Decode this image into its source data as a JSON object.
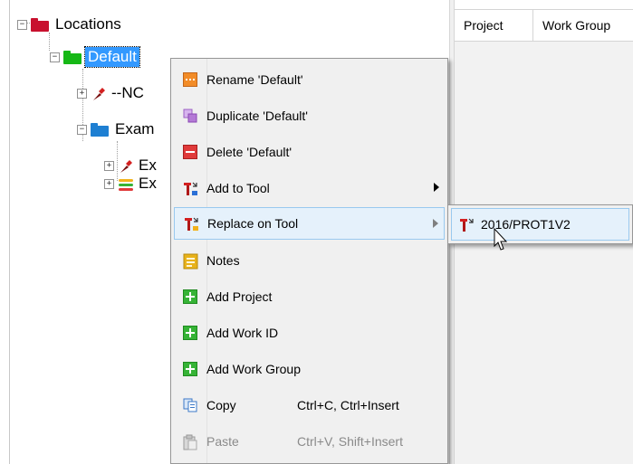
{
  "tree": {
    "root": {
      "label": "Locations",
      "expander": "−",
      "folder_color": "#c8102e"
    },
    "default": {
      "label": "Default",
      "expander": "−",
      "folder_color": "#16b816"
    },
    "child1": {
      "label": "--NC",
      "expander": "+",
      "icon": "tool-icon"
    },
    "child2": {
      "label": "Exam",
      "expander": "−",
      "folder_color": "#1e7fd2"
    },
    "child3": {
      "label": "Ex",
      "expander": "+",
      "icon": "tool-icon"
    },
    "child4": {
      "label": "Ex",
      "expander": "+",
      "icon": "layers-icon"
    }
  },
  "grid": {
    "columns": [
      "Project",
      "Work Group"
    ]
  },
  "context_menu": {
    "items": [
      {
        "label": "Rename 'Default'",
        "icon": "rename-icon"
      },
      {
        "label": "Duplicate 'Default'",
        "icon": "duplicate-icon"
      },
      {
        "label": "Delete 'Default'",
        "icon": "delete-icon"
      },
      {
        "label": "Add to Tool",
        "icon": "add-tool-icon",
        "submenu": true
      },
      {
        "label": "Replace on Tool",
        "icon": "replace-tool-icon",
        "submenu": true,
        "highlighted": true
      },
      {
        "label": "Notes",
        "icon": "notes-icon"
      },
      {
        "label": "Add Project",
        "icon": "plus-icon"
      },
      {
        "label": "Add Work ID",
        "icon": "plus-icon"
      },
      {
        "label": "Add Work Group",
        "icon": "plus-icon"
      },
      {
        "label": "Copy",
        "shortcut": "Ctrl+C, Ctrl+Insert",
        "icon": "copy-icon"
      },
      {
        "label": "Paste",
        "shortcut": "Ctrl+V, Shift+Insert",
        "icon": "paste-icon",
        "disabled": true
      }
    ]
  },
  "submenu": {
    "items": [
      {
        "label": "2016/PROT1V2",
        "icon": "tool-icon"
      }
    ]
  },
  "colors": {
    "selection": "#3399ff",
    "menu_bg": "#f0f0f0",
    "menu_hover": "#e5f1fb",
    "menu_hover_border": "#99c9ef",
    "plus_green": "#36b336",
    "delete_red": "#e03a3a",
    "notes_yellow": "#e8b21a",
    "rename_orange": "#f28c28",
    "duplicate_purple": "#b47ad6"
  }
}
